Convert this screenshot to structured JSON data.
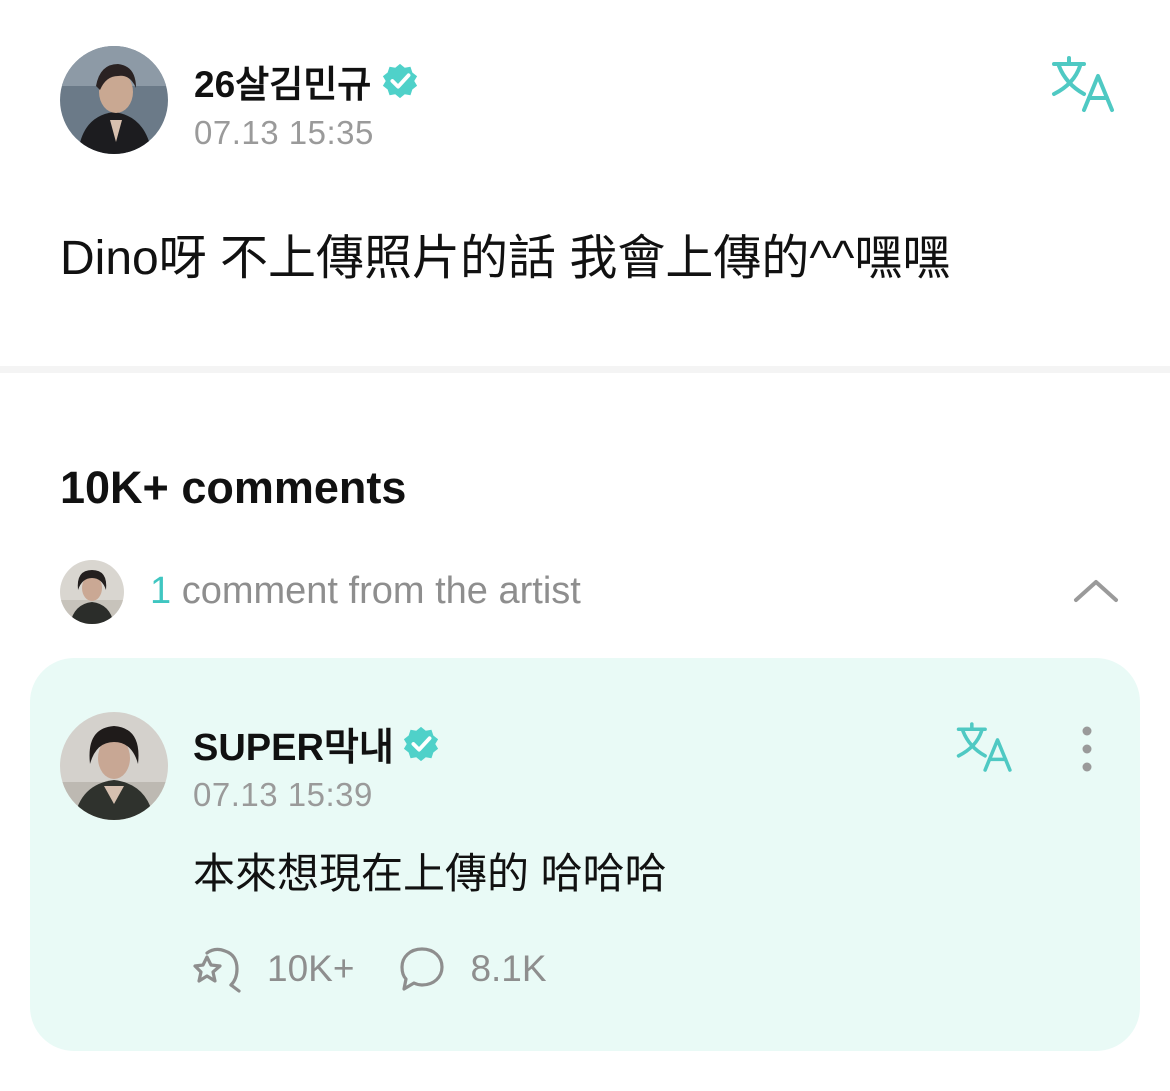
{
  "post": {
    "author": "26살김민규",
    "timestamp": "07.13 15:35",
    "body": "Dino呀 不上傳照片的話 我會上傳的^^嘿嘿",
    "icons": {
      "verified": "verified-badge-icon",
      "translate": "translate-icon"
    }
  },
  "comments": {
    "heading": "10K+ comments",
    "artist_count": "1",
    "artist_label": "comment from the artist",
    "collapse_icon": "chevron-up-icon",
    "items": [
      {
        "author": "SUPER막내",
        "timestamp": "07.13 15:39",
        "body": "本來想現在上傳的 哈哈哈",
        "cheers_count": "10K+",
        "replies_count": "8.1K"
      }
    ]
  },
  "colors": {
    "accent": "#3fc6c1",
    "comment_card_bg": "#e9faf6",
    "muted_text": "#9a9a9a",
    "primary_text": "#111111"
  }
}
